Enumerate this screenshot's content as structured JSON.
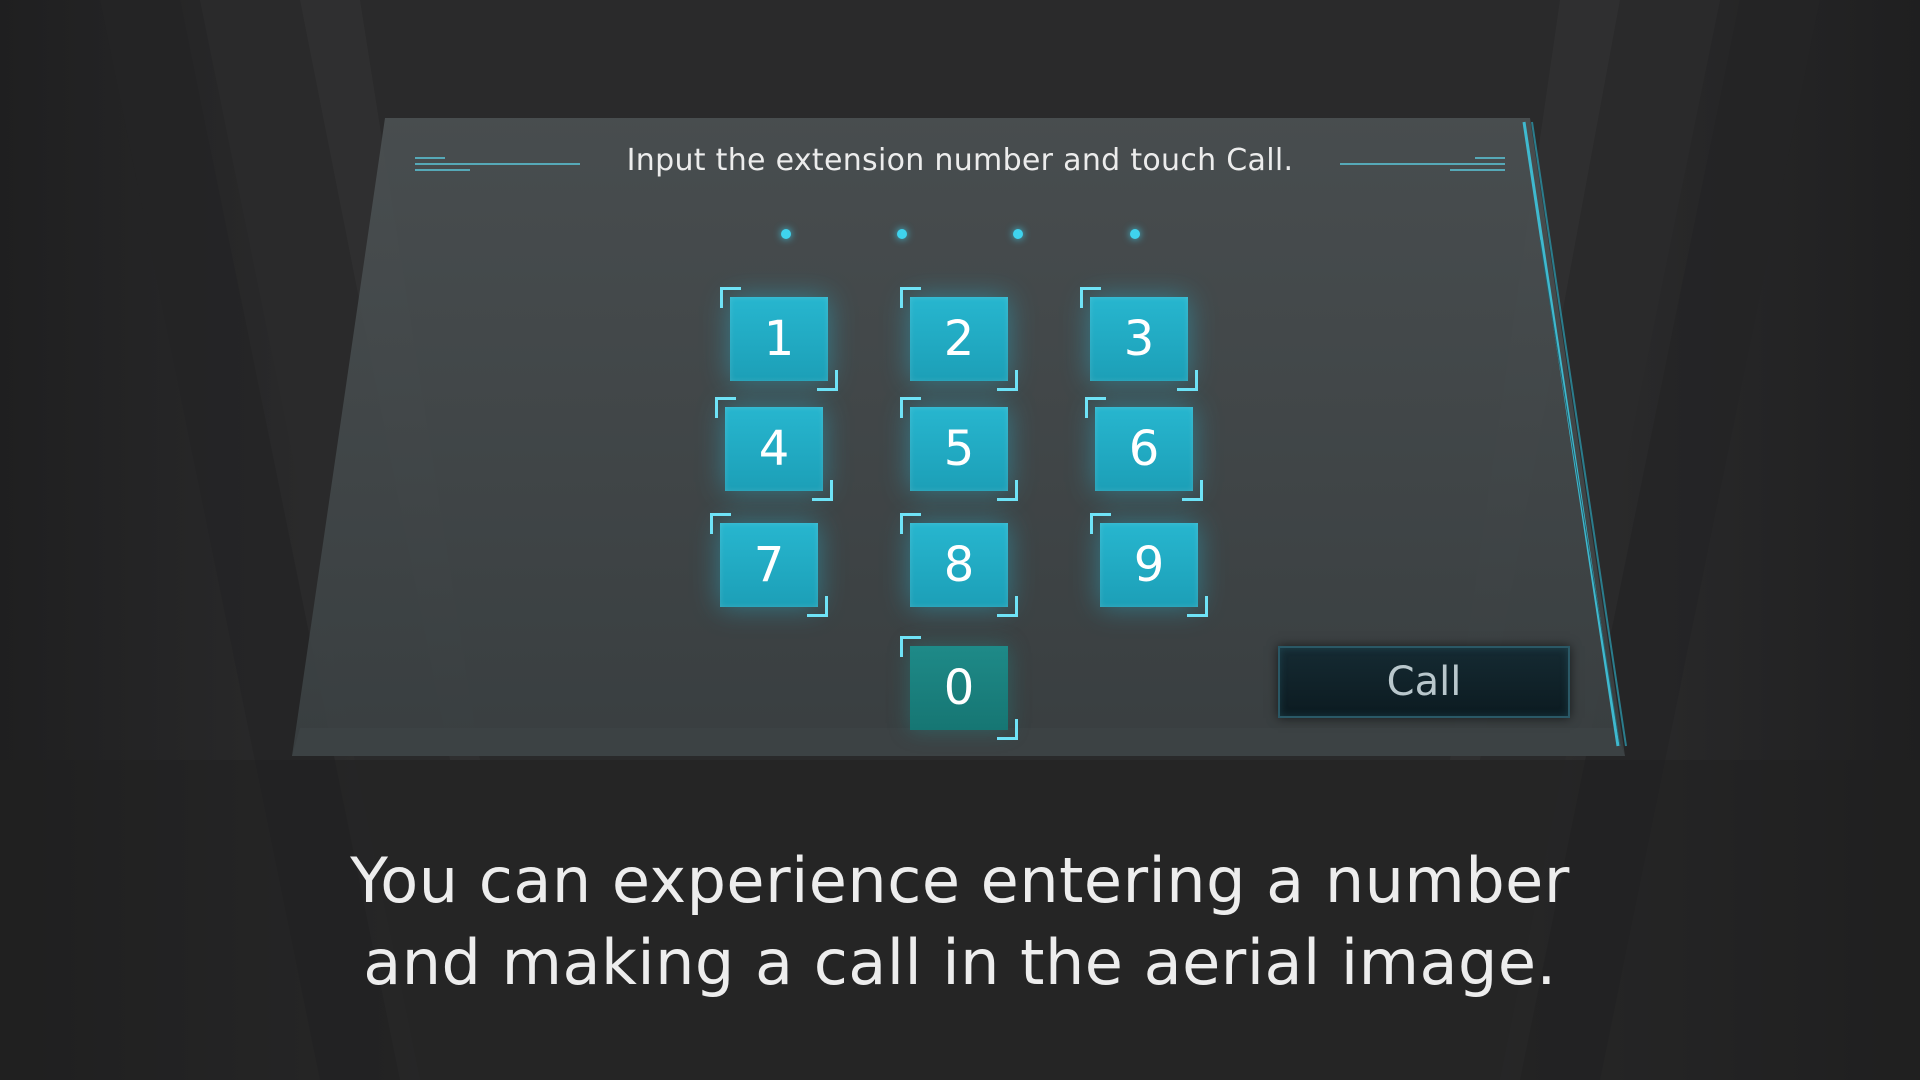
{
  "panel": {
    "instruction": "Input the extension number and touch Call.",
    "pin_slots": 4
  },
  "keypad": {
    "keys": [
      "1",
      "2",
      "3",
      "4",
      "5",
      "6",
      "7",
      "8",
      "9",
      "0"
    ]
  },
  "call_button": {
    "label": "Call"
  },
  "caption": {
    "line1": "You can experience entering a number",
    "line2": "and making a call in the aerial image."
  },
  "colors": {
    "accent": "#3fd3ee",
    "key": "#1fa9c1",
    "key_zero": "#1b807e",
    "background": "#2b2b2c"
  }
}
